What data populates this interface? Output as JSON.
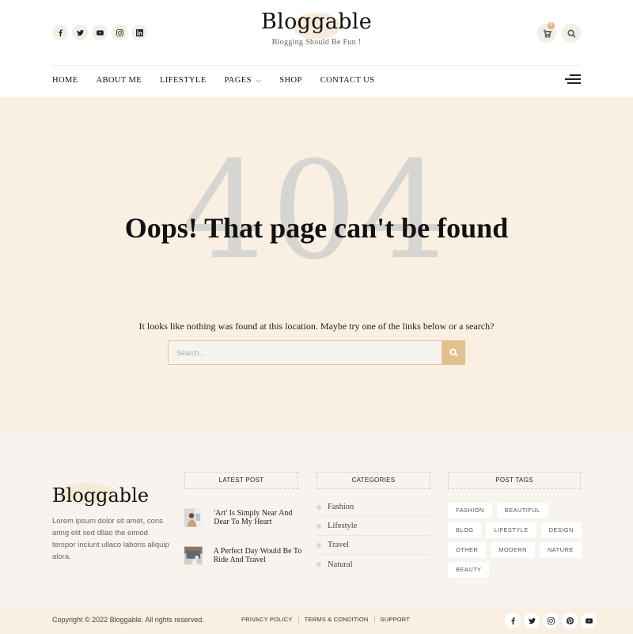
{
  "header": {
    "logo": "Bloggable",
    "tagline": "Blogging Should Be Fun !",
    "cart_count": "0",
    "social_icons": [
      "facebook-icon",
      "twitter-icon",
      "youtube-icon",
      "instagram-icon",
      "linkedin-icon"
    ]
  },
  "nav": {
    "items": [
      {
        "label": "HOME"
      },
      {
        "label": "ABOUT ME"
      },
      {
        "label": "LIFESTYLE"
      },
      {
        "label": "PAGES",
        "dropdown": true
      },
      {
        "label": "SHOP"
      },
      {
        "label": "CONTACT US"
      }
    ]
  },
  "error": {
    "code": "404",
    "title": "Oops! That page can't be found",
    "message": "It looks like nothing was found at this location. Maybe try one of the links below or a search?",
    "search_placeholder": "Search..."
  },
  "footer": {
    "logo": "Bloggable",
    "about": "Lorem ipsum dolor sit amet, cons aring elit sed dllao the eimod tempor inciunt ullaco laboris aliquip alora.",
    "latest_post_title": "LATEST POST",
    "posts": [
      {
        "title": "'Art' Is Simply Near And Dear To My Heart"
      },
      {
        "title": "A Perfect Day Would Be To Ride And Travel"
      }
    ],
    "categories_title": "CATEGORIES",
    "categories": [
      "Fashion",
      "Lifestyle",
      "Travel",
      "Natural"
    ],
    "tags_title": "POST TAGS",
    "tags": [
      "FASHION",
      "BEAUTIFUL",
      "BLOG",
      "LIFESTYLE",
      "DESIGN",
      "OTHER",
      "MODERN",
      "NATURE",
      "BEAUTY"
    ]
  },
  "bottom": {
    "copyright": "Copyright © 2022 Bloggable. All rights reserved.",
    "links": [
      "PRIVACY POLICY",
      "TERMS & CONDITION",
      "SUPPORT"
    ],
    "social_icons": [
      "facebook-icon",
      "twitter-icon",
      "instagram-icon",
      "pinterest-icon",
      "youtube-icon"
    ]
  },
  "colors": {
    "accent": "#e3c18f",
    "hero_bg": "#f9efe3",
    "footer_bg": "#f7f4ef",
    "big_number": "#d7d5d1"
  }
}
